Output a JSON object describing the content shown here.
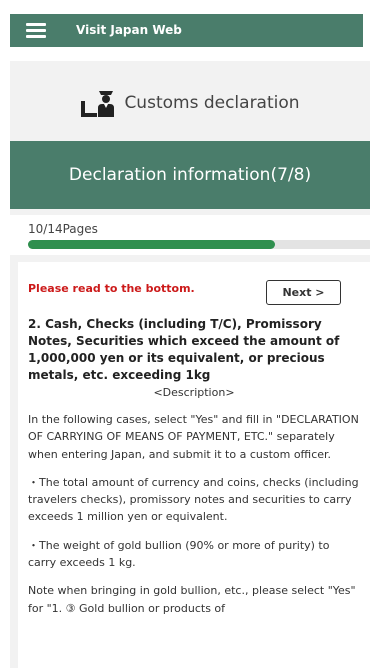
{
  "header": {
    "brand": "Visit Japan Web",
    "menu_icon": "hamburger-menu-icon"
  },
  "customs": {
    "icon": "customs-officer-icon",
    "title": "Customs declaration"
  },
  "section": {
    "title": "Declaration information(7/8)"
  },
  "progress": {
    "label": "10/14Pages",
    "fraction": 0.714
  },
  "content": {
    "notice": "Please read to the bottom.",
    "next_label": "Next >",
    "heading": "2. Cash, Checks (including T/C), Promissory Notes, Securities which exceed the amount of 1,000,000 yen or its equivalent, or precious metals, etc. exceeding 1kg",
    "description_label": "<Description>",
    "paragraphs": [
      "In the following cases, select \"Yes\" and fill in \"DECLARATION OF CARRYING OF MEANS OF PAYMENT, ETC.\" separately when entering Japan, and submit it to a custom officer.",
      "・The total amount of currency and coins, checks (including travelers checks), promissory notes and securities to carry exceeds 1 million yen or equivalent.",
      "・The weight of gold bullion (90% or more of purity) to carry exceeds 1 kg.",
      "Note when bringing in gold bullion, etc., please select \"Yes\" for \"1. ③ Gold bullion or products of"
    ]
  },
  "colors": {
    "brand_green": "#4a7d6b",
    "progress_green": "#2f8f4e",
    "notice_red": "#cc1a1a"
  }
}
